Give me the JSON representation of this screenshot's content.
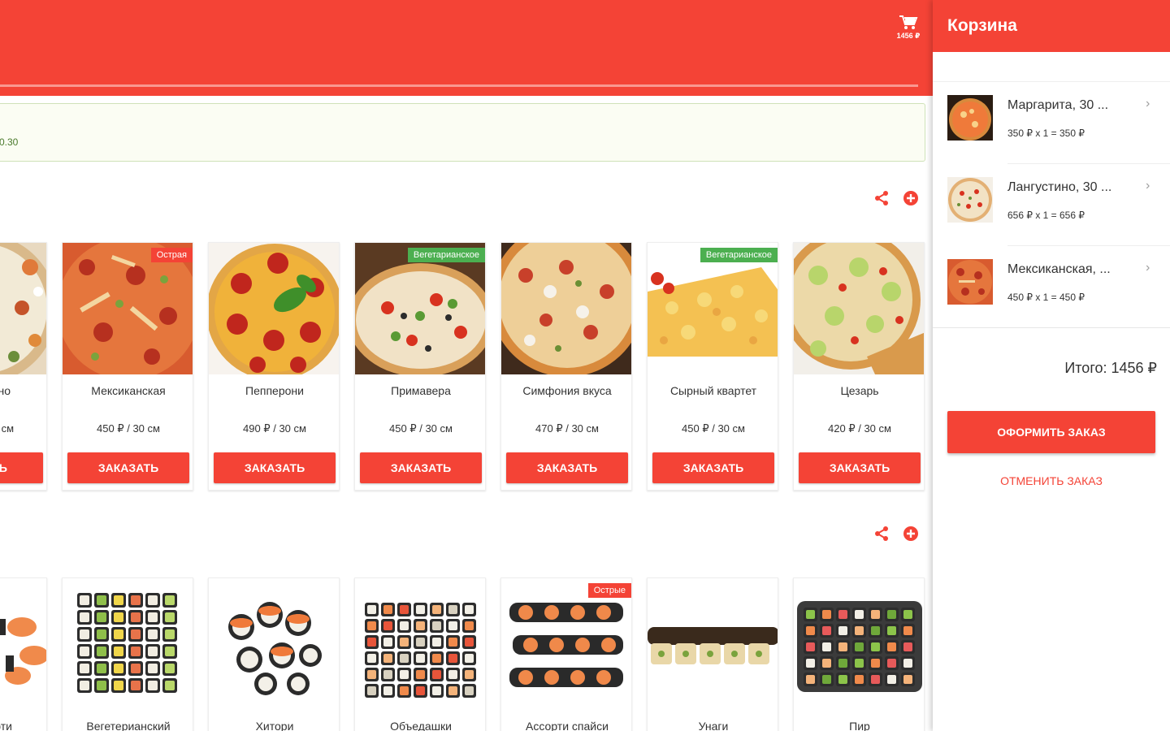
{
  "header": {
    "cart_total_short": "1456 ₽",
    "cart_icon": "cart-icon"
  },
  "notice": {
    "text": "0.30"
  },
  "sections": [
    {
      "share_icon": "share-icon",
      "add_icon": "add-circle-icon"
    },
    {
      "share_icon": "share-icon",
      "add_icon": "add-circle-icon"
    }
  ],
  "pizzas": [
    {
      "name": "Ланггустино",
      "name_visible": "но",
      "price": "... см",
      "order_label": "ЗАКАЗАТЬ"
    },
    {
      "name": "Мексиканская",
      "price": "450 ₽ / 30 см",
      "badge": "Острая",
      "order_label": "ЗАКАЗАТЬ"
    },
    {
      "name": "Пепперони",
      "price": "490 ₽ / 30 см",
      "order_label": "ЗАКАЗАТЬ"
    },
    {
      "name": "Примавера",
      "price": "450 ₽ / 30 см",
      "badge": "Вегетарианское",
      "order_label": "ЗАКАЗАТЬ"
    },
    {
      "name": "Симфония вкуса",
      "price": "470 ₽ / 30 см",
      "order_label": "ЗАКАЗАТЬ"
    },
    {
      "name": "Сырный квартет",
      "price": "450 ₽ / 30 см",
      "badge": "Вегетарианское",
      "order_label": "ЗАКАЗАТЬ"
    },
    {
      "name": "Цезарь",
      "price": "420 ₽ / 30 см",
      "order_label": "ЗАКАЗАТЬ"
    }
  ],
  "pizza_first_partial": {
    "name": "но",
    "price": "см",
    "order": "ТЬ"
  },
  "sushi": [
    {
      "name": "Ассорти"
    },
    {
      "name": "Вегетерианский"
    },
    {
      "name": "Хитори"
    },
    {
      "name": "Объедашки"
    },
    {
      "name": "Ассорти спайси",
      "badge": "Острые"
    },
    {
      "name": "Унаги"
    },
    {
      "name": "Пир"
    }
  ],
  "sushi_first_partial": {
    "name": "ссорти"
  },
  "cart": {
    "title": "Корзина",
    "items": [
      {
        "name": "Маргарита, 30 ...",
        "calc": "350 ₽ x 1 = 350 ₽"
      },
      {
        "name": "Лангустино, 30 ...",
        "calc": "656 ₽ x 1 = 656 ₽"
      },
      {
        "name": "Мексиканская, ...",
        "calc": "450 ₽ x 1 = 450 ₽"
      }
    ],
    "total": "Итого: 1456 ₽",
    "checkout_label": "ОФОРМИТЬ ЗАКАЗ",
    "cancel_label": "ОТМЕНИТЬ ЗАКАЗ"
  },
  "colors": {
    "primary": "#f44336",
    "badge_vegetarian": "#4caf50",
    "notice_bg": "#fbfdf3"
  }
}
